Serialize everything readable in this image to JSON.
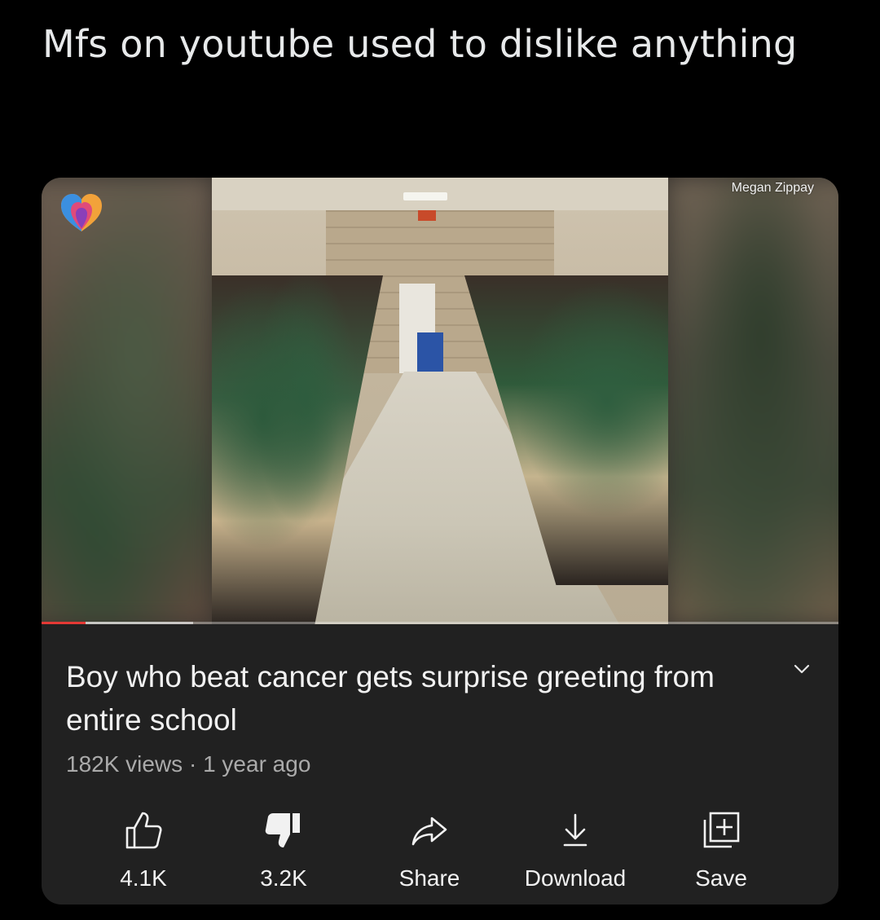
{
  "tweet": {
    "text": "Mfs on youtube used to dislike anything"
  },
  "video": {
    "watermark": "Megan Zippay",
    "progress_played": 0.055,
    "progress_buffered": 0.19,
    "title": "Boy who beat cancer gets surprise greeting from entire school",
    "meta": "182K views · 1 year ago"
  },
  "actions": {
    "like_label": "4.1K",
    "dislike_label": "3.2K",
    "share_label": "Share",
    "download_label": "Download",
    "save_label": "Save"
  },
  "colors": {
    "background": "#000000",
    "card": "#212121",
    "progress_red": "#e53935"
  }
}
